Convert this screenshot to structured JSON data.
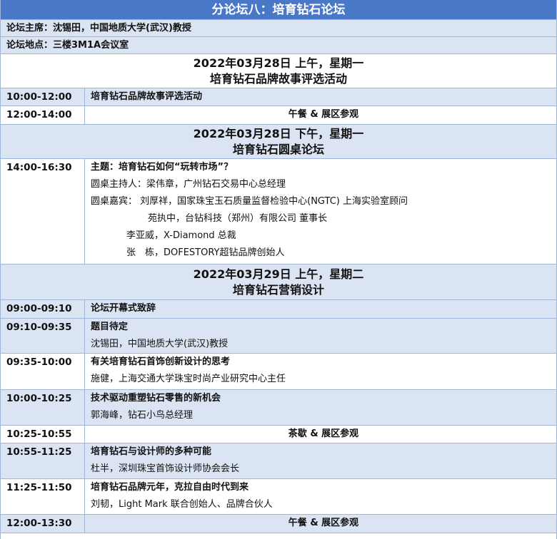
{
  "title": "分论坛八：培育钻石论坛",
  "chair": "论坛主席：沈锡田，中国地质大学(武汉)教授",
  "venue": "论坛地点：三楼3M1A会议室",
  "days": [
    {
      "date": "2022年03月28日 上午，星期一",
      "topic": "培育钻石品牌故事评选活动",
      "rows": [
        {
          "time": "10:00-12:00",
          "lines": [
            "培育钻石品牌故事评选活动"
          ]
        },
        {
          "time": "12:00-14:00",
          "center": "午餐 & 展区参观"
        }
      ]
    },
    {
      "date": "2022年03月28日 下午，星期一",
      "topic": "培育钻石圆桌论坛",
      "rows": [
        {
          "time": "14:00-16:30",
          "lines": [
            "主题：培育钻石如何“玩转市场”？",
            "圆桌主持人：梁伟章，广州钻石交易中心总经理",
            "圆桌嘉宾：  刘厚祥，国家珠宝玉石质量监督检验中心(NGTC) 上海实验室顾问",
            "苑执中，台钻科技（郑州）有限公司 董事长",
            "李亚威，X-Diamond 总裁",
            "张　栋，DOFESTORY超钻品牌创始人"
          ]
        }
      ]
    },
    {
      "date": "2022年03月29日 上午，星期二",
      "topic": "培育钻石营销设计",
      "rows": [
        {
          "time": "09:00-09:10",
          "lines": [
            "论坛开幕式致辞"
          ]
        },
        {
          "time": "09:10-09:35",
          "lines": [
            "题目待定",
            "沈锡田，中国地质大学(武汉)教授"
          ]
        },
        {
          "time": "09:35-10:00",
          "lines": [
            "有关培育钻石首饰创新设计的思考",
            "施健，上海交通大学珠宝时尚产业研究中心主任"
          ]
        },
        {
          "time": "10:00-10:25",
          "lines": [
            "技术驱动重塑钻石零售的新机会",
            "郭海峰，钻石小鸟总经理"
          ]
        },
        {
          "time": "10:25-10:55",
          "center": "茶歇 & 展区参观"
        },
        {
          "time": "10:55-11:25",
          "lines": [
            "培育钻石与设计师的多种可能",
            "杜半，深圳珠宝首饰设计师协会会长"
          ]
        },
        {
          "time": "11:25-11:50",
          "lines": [
            "培育钻石品牌元年，克拉自由时代到来",
            "刘韧，Light Mark 联合创始人、品牌合伙人"
          ]
        },
        {
          "time": "12:00-13:30",
          "center": "午餐 & 展区参观"
        }
      ]
    }
  ]
}
